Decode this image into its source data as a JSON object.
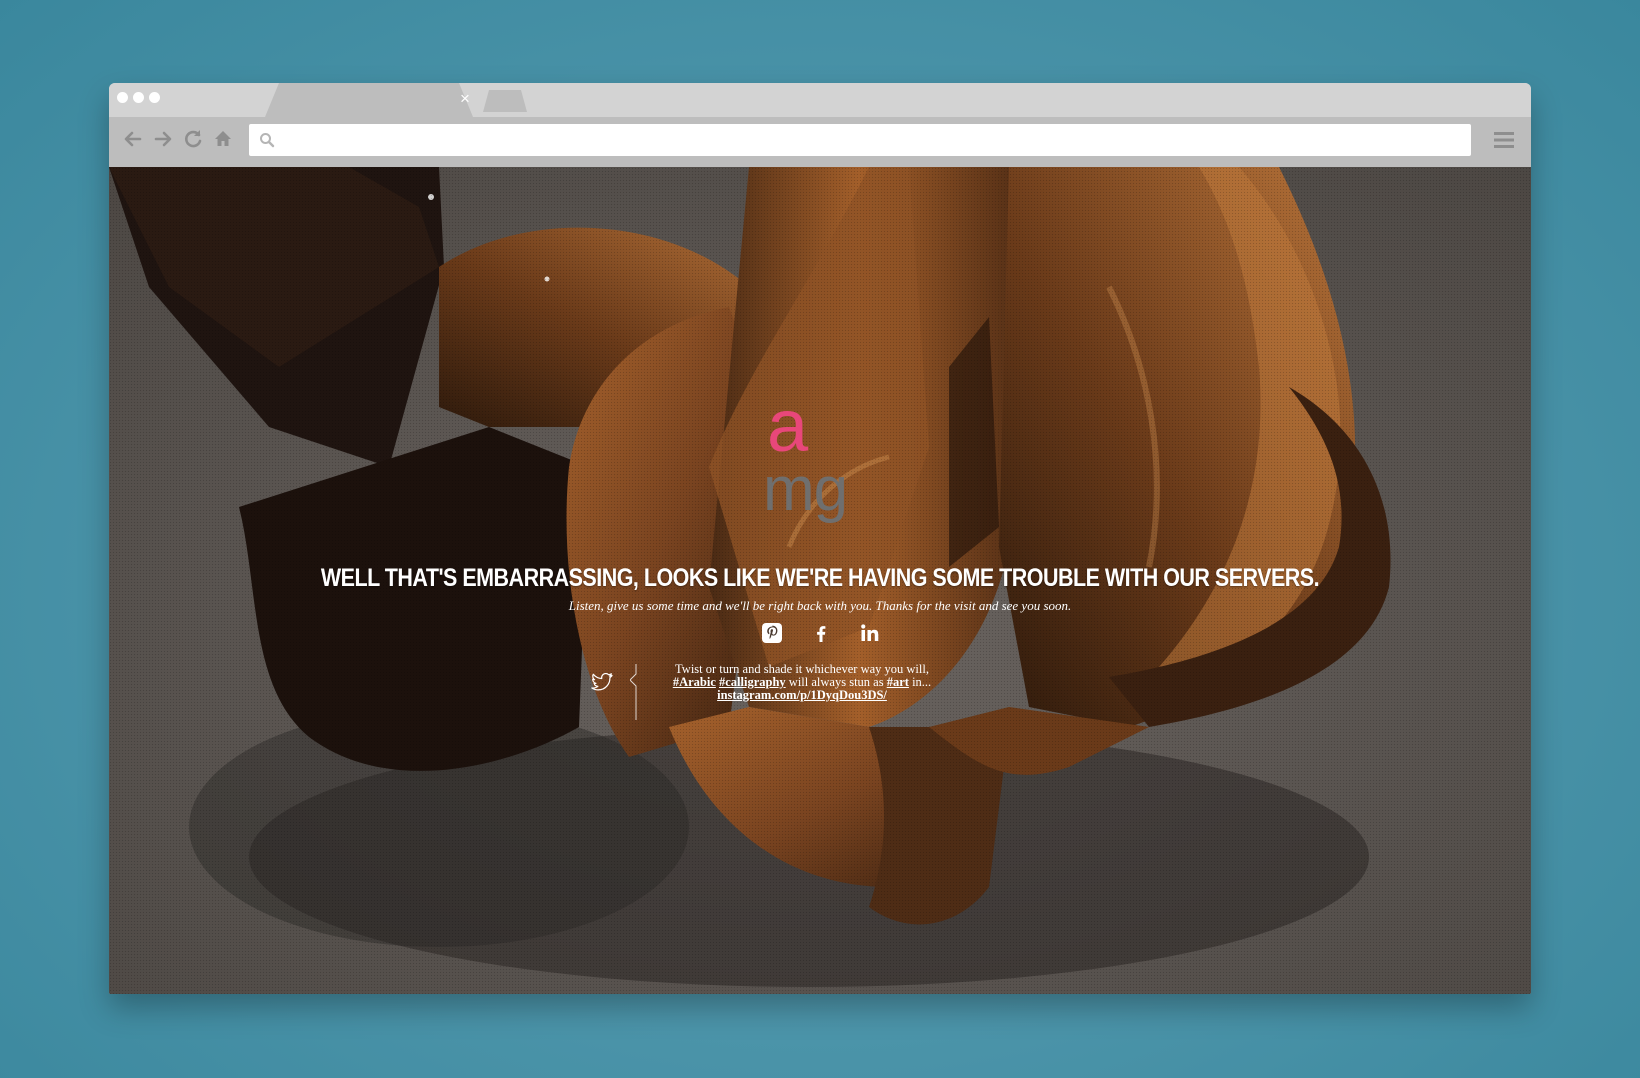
{
  "browser": {
    "tab_close_glyph": "×",
    "url": {
      "value": "",
      "placeholder": ""
    }
  },
  "page": {
    "logo": {
      "top_letter": "a",
      "bottom_letters": "mg"
    },
    "headline": "WELL THAT'S EMBARRASSING, LOOKS LIKE WE'RE HAVING SOME TROUBLE WITH OUR SERVERS.",
    "subline": "Listen, give us some time and we'll be right back with you. Thanks for the visit and see you soon.",
    "social": [
      {
        "name": "pinterest",
        "icon": "pinterest-icon"
      },
      {
        "name": "facebook",
        "icon": "facebook-icon"
      },
      {
        "name": "linkedin",
        "icon": "linkedin-icon"
      }
    ],
    "tweet": {
      "icon": "twitter-icon",
      "line1": "Twist or turn and shade it whichever way you will,",
      "tag_arabic": "#Arabic",
      "tag_calligraphy": "#calligraphy",
      "mid_text": "will always stun as",
      "tag_art": "#art",
      "tail_text": "in...",
      "link": "instagram.com/p/1DyqDou3DS/"
    }
  },
  "colors": {
    "backdrop": "#3a879d",
    "chrome": "#d3d3d3",
    "toolbar": "#bdbdbd",
    "logo_accent": "#e8477a",
    "logo_gray": "#6f6f6f"
  }
}
